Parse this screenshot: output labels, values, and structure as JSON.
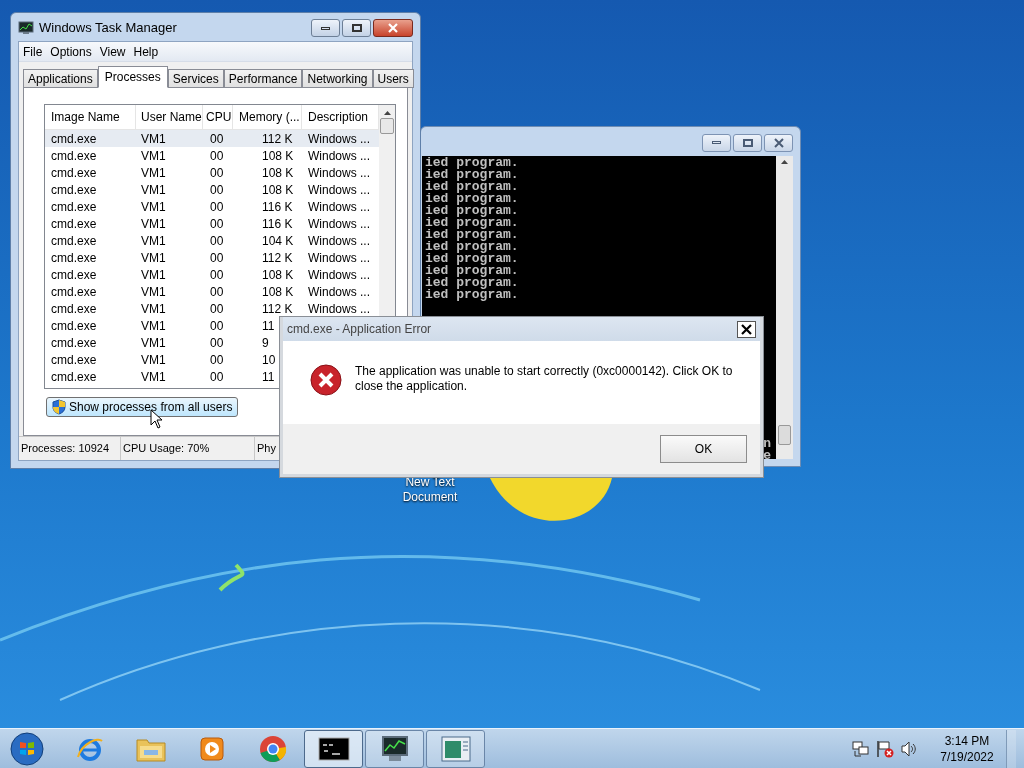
{
  "task_manager": {
    "title": "Windows Task Manager",
    "menu": [
      "File",
      "Options",
      "View",
      "Help"
    ],
    "tabs": [
      {
        "label": "Applications",
        "selected": false
      },
      {
        "label": "Processes",
        "selected": true
      },
      {
        "label": "Services",
        "selected": false
      },
      {
        "label": "Performance",
        "selected": false
      },
      {
        "label": "Networking",
        "selected": false
      },
      {
        "label": "Users",
        "selected": false
      }
    ],
    "columns": [
      "Image Name",
      "User Name",
      "CPU",
      "Memory (...",
      "Description"
    ],
    "rows": [
      {
        "image_name": "cmd.exe",
        "user_name": "VM1",
        "cpu": "00",
        "memory": "112 K",
        "description": "Windows ...",
        "selected": true
      },
      {
        "image_name": "cmd.exe",
        "user_name": "VM1",
        "cpu": "00",
        "memory": "108 K",
        "description": "Windows ...",
        "selected": false
      },
      {
        "image_name": "cmd.exe",
        "user_name": "VM1",
        "cpu": "00",
        "memory": "108 K",
        "description": "Windows ...",
        "selected": false
      },
      {
        "image_name": "cmd.exe",
        "user_name": "VM1",
        "cpu": "00",
        "memory": "108 K",
        "description": "Windows ...",
        "selected": false
      },
      {
        "image_name": "cmd.exe",
        "user_name": "VM1",
        "cpu": "00",
        "memory": "116 K",
        "description": "Windows ...",
        "selected": false
      },
      {
        "image_name": "cmd.exe",
        "user_name": "VM1",
        "cpu": "00",
        "memory": "116 K",
        "description": "Windows ...",
        "selected": false
      },
      {
        "image_name": "cmd.exe",
        "user_name": "VM1",
        "cpu": "00",
        "memory": "104 K",
        "description": "Windows ...",
        "selected": false
      },
      {
        "image_name": "cmd.exe",
        "user_name": "VM1",
        "cpu": "00",
        "memory": "112 K",
        "description": "Windows ...",
        "selected": false
      },
      {
        "image_name": "cmd.exe",
        "user_name": "VM1",
        "cpu": "00",
        "memory": "108 K",
        "description": "Windows ...",
        "selected": false
      },
      {
        "image_name": "cmd.exe",
        "user_name": "VM1",
        "cpu": "00",
        "memory": "108 K",
        "description": "Windows ...",
        "selected": false
      },
      {
        "image_name": "cmd.exe",
        "user_name": "VM1",
        "cpu": "00",
        "memory": "112 K",
        "description": "Windows ...",
        "selected": false
      },
      {
        "image_name": "cmd.exe",
        "user_name": "VM1",
        "cpu": "00",
        "memory": "11",
        "selected": false
      },
      {
        "image_name": "cmd.exe",
        "user_name": "VM1",
        "cpu": "00",
        "memory": "9",
        "selected": false
      },
      {
        "image_name": "cmd.exe",
        "user_name": "VM1",
        "cpu": "00",
        "memory": "10",
        "selected": false
      },
      {
        "image_name": "cmd.exe",
        "user_name": "VM1",
        "cpu": "00",
        "memory": "11",
        "selected": false
      }
    ],
    "button": "Show processes from all users",
    "status_bar": [
      "Processes: 10924",
      "CPU Usage: 70%",
      "Phy"
    ]
  },
  "console": {
    "lines": [
      "ied program.",
      "ied program.",
      "ied program.",
      "ied program.",
      "ied program.",
      "ied program.",
      "ied program.",
      "ied program.",
      "ied program.",
      "ied program.",
      "ied program.",
      "ied program."
    ],
    "fragments": [
      "n",
      "e"
    ]
  },
  "desktop_icon": {
    "label": "New Text Document"
  },
  "dialog": {
    "title": "cmd.exe - Application Error",
    "message": "The application was unable to start correctly (0xc0000142). Click OK to close the application.",
    "button": "OK"
  },
  "taskbar": {
    "apps": [
      {
        "kind": "internet-explorer",
        "running": false,
        "selected": false
      },
      {
        "kind": "file-explorer",
        "running": false,
        "selected": false
      },
      {
        "kind": "media-player",
        "running": false,
        "selected": false
      },
      {
        "kind": "chrome",
        "running": false,
        "selected": false
      },
      {
        "kind": "console",
        "running": true,
        "selected": true
      },
      {
        "kind": "task-manager",
        "running": true,
        "selected": false
      },
      {
        "kind": "notepad",
        "running": true,
        "selected": false
      }
    ],
    "clock": {
      "time": "3:14 PM",
      "date": "7/19/2022"
    }
  }
}
